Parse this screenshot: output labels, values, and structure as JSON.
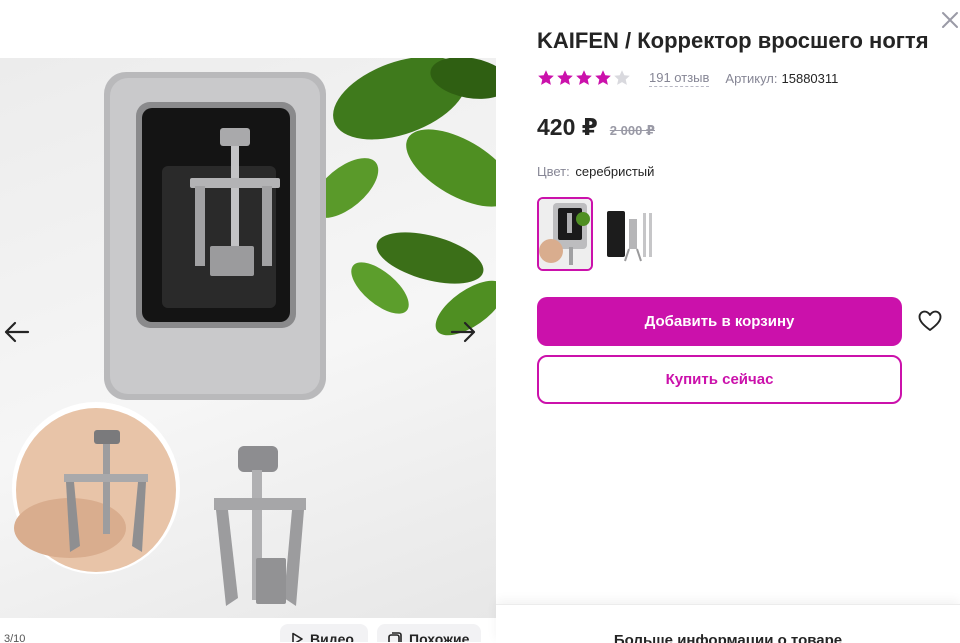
{
  "gallery": {
    "counter": "3/10",
    "video_label": "Видео",
    "similar_label": "Похожие"
  },
  "product": {
    "title": "KAIFEN / Корректор вросшего ногтя",
    "rating": 4,
    "rating_max": 5,
    "reviews_label": "191 отзыв",
    "article_label": "Артикул:",
    "article_value": "15880311",
    "price": "420 ₽",
    "old_price": "2 000 ₽",
    "color_label": "Цвет:",
    "color_value": "серебристый",
    "add_to_cart_label": "Добавить в корзину",
    "buy_now_label": "Купить сейчас",
    "more_info_label": "Больше информации о товаре"
  },
  "colors": {
    "accent": "#cb11ab",
    "star_filled": "#cb11ab",
    "star_empty": "#d9d9de",
    "text": "#242424",
    "muted": "#868695"
  },
  "icons": {
    "prev": "arrow-left-icon",
    "next": "arrow-right-icon",
    "close": "close-icon",
    "favorite": "heart-icon",
    "video": "play-icon",
    "similar": "similar-icon"
  }
}
